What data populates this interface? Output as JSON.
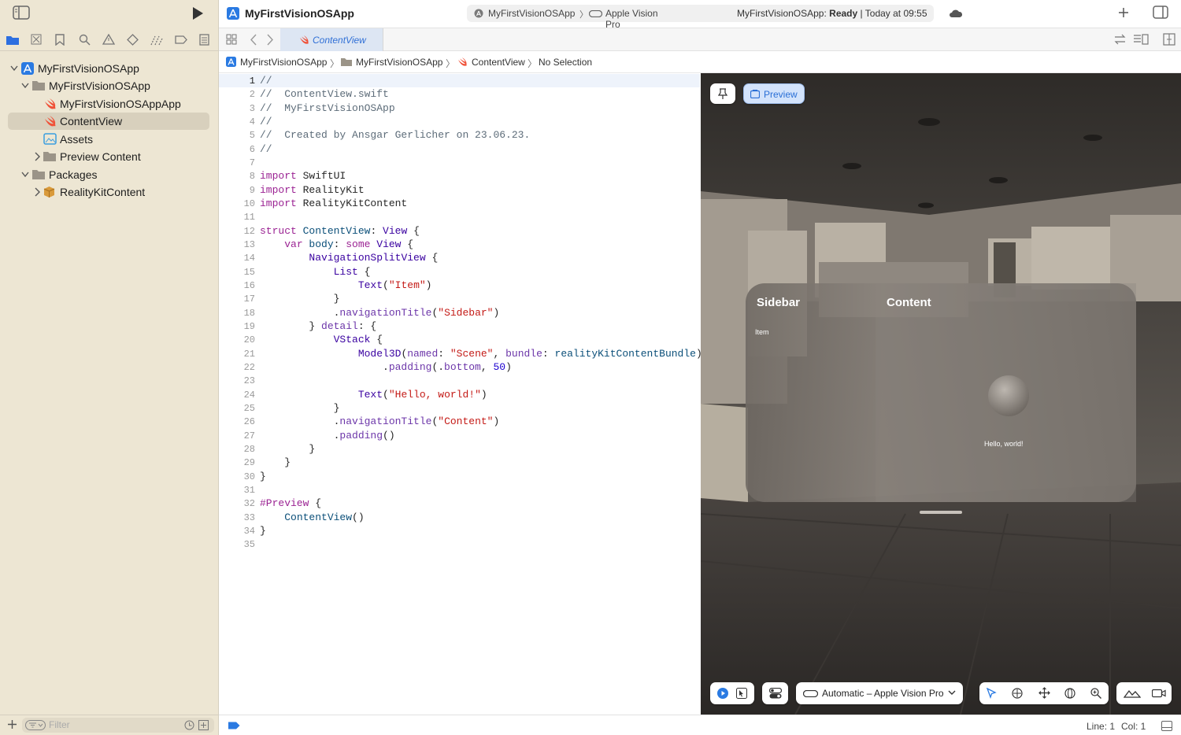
{
  "window": {
    "scheme": "MyFirstVisionOSApp",
    "destination": "Apple Vision Pro",
    "status_app": "MyFirstVisionOSApp:",
    "status_state": "Ready",
    "status_time": "| Today at 09:55",
    "title": "MyFirstVisionOSApp"
  },
  "navigator": {
    "items": [
      {
        "label": "MyFirstVisionOSApp",
        "icon": "project-icon"
      },
      {
        "label": "MyFirstVisionOSApp",
        "icon": "folder-icon"
      },
      {
        "label": "MyFirstVisionOSAppApp",
        "icon": "swift-file-icon"
      },
      {
        "label": "ContentView",
        "icon": "swift-file-icon"
      },
      {
        "label": "Assets",
        "icon": "asset-catalog-icon"
      },
      {
        "label": "Preview Content",
        "icon": "folder-icon"
      },
      {
        "label": "Packages",
        "icon": "folder-icon"
      },
      {
        "label": "RealityKitContent",
        "icon": "package-icon"
      }
    ],
    "filter_placeholder": "Filter"
  },
  "tab": {
    "label": "ContentView"
  },
  "breadcrumb": {
    "project": "MyFirstVisionOSApp",
    "group": "MyFirstVisionOSApp",
    "file": "ContentView",
    "symbol": "No Selection"
  },
  "code": {
    "line_numbers": [
      "1",
      "2",
      "3",
      "4",
      "5",
      "6",
      "7",
      "8",
      "9",
      "10",
      "11",
      "12",
      "13",
      "14",
      "15",
      "16",
      "17",
      "18",
      "19",
      "20",
      "21",
      "22",
      "23",
      "24",
      "25",
      "26",
      "27",
      "28",
      "29",
      "30",
      "31",
      "32",
      "33",
      "34",
      "35"
    ]
  },
  "preview": {
    "preview_label": "Preview",
    "window_sidebar_title": "Sidebar",
    "window_sidebar_item": "Item",
    "window_content_title": "Content",
    "window_content_text": "Hello, world!",
    "device_label": "Automatic – Apple Vision Pro"
  },
  "status": {
    "line": "Line: 1",
    "col": "Col: 1"
  }
}
